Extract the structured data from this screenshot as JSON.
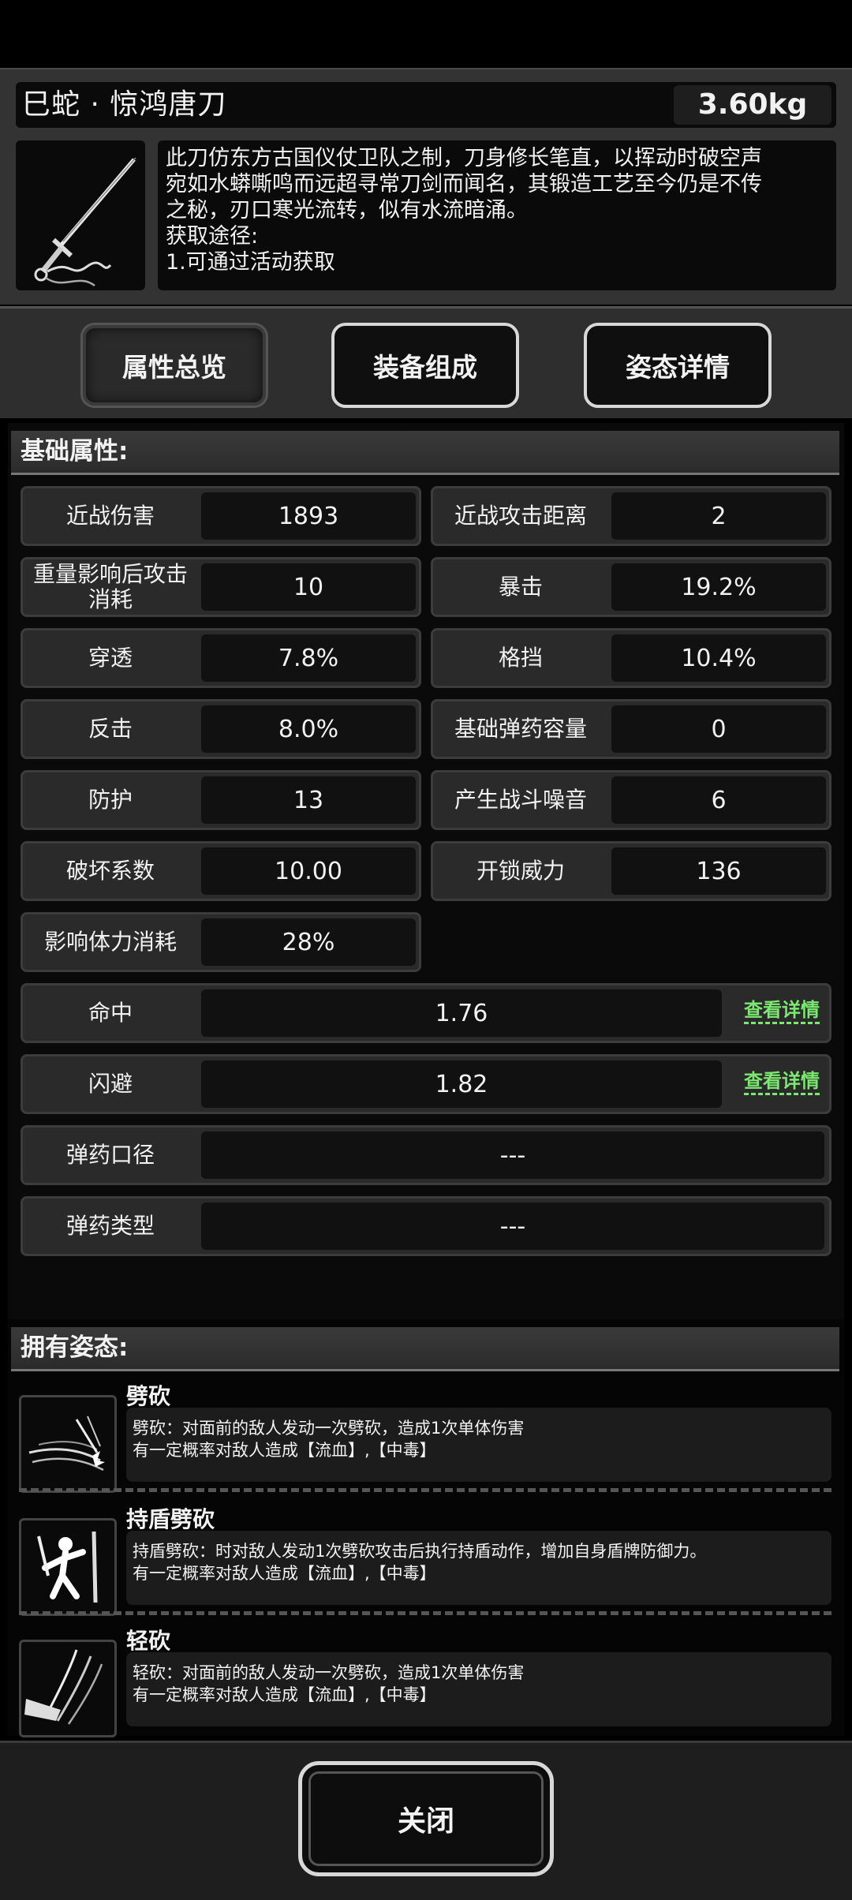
{
  "item": {
    "name": "巳蛇 · 惊鸿唐刀",
    "weight": "3.60kg",
    "description": [
      "此刀仿东方古国仪仗卫队之制，刀身修长笔直，以挥动时破空声",
      "宛如水蟒嘶鸣而远超寻常刀剑而闻名，其锻造工艺至今仍是不传",
      "之秘，刃口寒光流转，似有水流暗涌。",
      "获取途径:",
      "1.可通过活动获取"
    ]
  },
  "tabs": [
    {
      "label": "属性总览",
      "active": true
    },
    {
      "label": "装备组成",
      "active": false
    },
    {
      "label": "姿态详情",
      "active": false
    }
  ],
  "basic": {
    "title": "基础属性:",
    "left": [
      {
        "label": "近战伤害",
        "value": "1893"
      },
      {
        "label": "重量影响后攻击消耗",
        "value": "10"
      },
      {
        "label": "穿透",
        "value": "7.8%"
      },
      {
        "label": "反击",
        "value": "8.0%"
      },
      {
        "label": "防护",
        "value": "13"
      },
      {
        "label": "破坏系数",
        "value": "10.00"
      },
      {
        "label": "影响体力消耗",
        "value": "28%"
      }
    ],
    "right": [
      {
        "label": "近战攻击距离",
        "value": "2"
      },
      {
        "label": "暴击",
        "value": "19.2%"
      },
      {
        "label": "格挡",
        "value": "10.4%"
      },
      {
        "label": "基础弹药容量",
        "value": "0"
      },
      {
        "label": "产生战斗噪音",
        "value": "6"
      },
      {
        "label": "开锁威力",
        "value": "136"
      }
    ],
    "wide": [
      {
        "label": "命中",
        "value": "1.76",
        "link": "查看详情"
      },
      {
        "label": "闪避",
        "value": "1.82",
        "link": "查看详情"
      },
      {
        "label": "弹药口径",
        "value": "---"
      },
      {
        "label": "弹药类型",
        "value": "---"
      }
    ]
  },
  "stances": {
    "title": "拥有姿态:",
    "items": [
      {
        "name": "劈砍",
        "icon": "slash-icon",
        "lines": [
          "劈砍：对面前的敌人发动一次劈砍，造成1次单体伤害",
          "有一定概率对敌人造成【流血】,【中毒】"
        ]
      },
      {
        "name": "持盾劈砍",
        "icon": "shield-slash-icon",
        "lines": [
          "持盾劈砍：时对敌人发动1次劈砍攻击后执行持盾动作，增加自身盾牌防御力。",
          "有一定概率对敌人造成【流血】,【中毒】"
        ]
      },
      {
        "name": "轻砍",
        "icon": "light-slash-icon",
        "lines": [
          "轻砍：对面前的敌人发动一次劈砍，造成1次单体伤害",
          "有一定概率对敌人造成【流血】,【中毒】"
        ]
      }
    ]
  },
  "close_label": "关闭"
}
